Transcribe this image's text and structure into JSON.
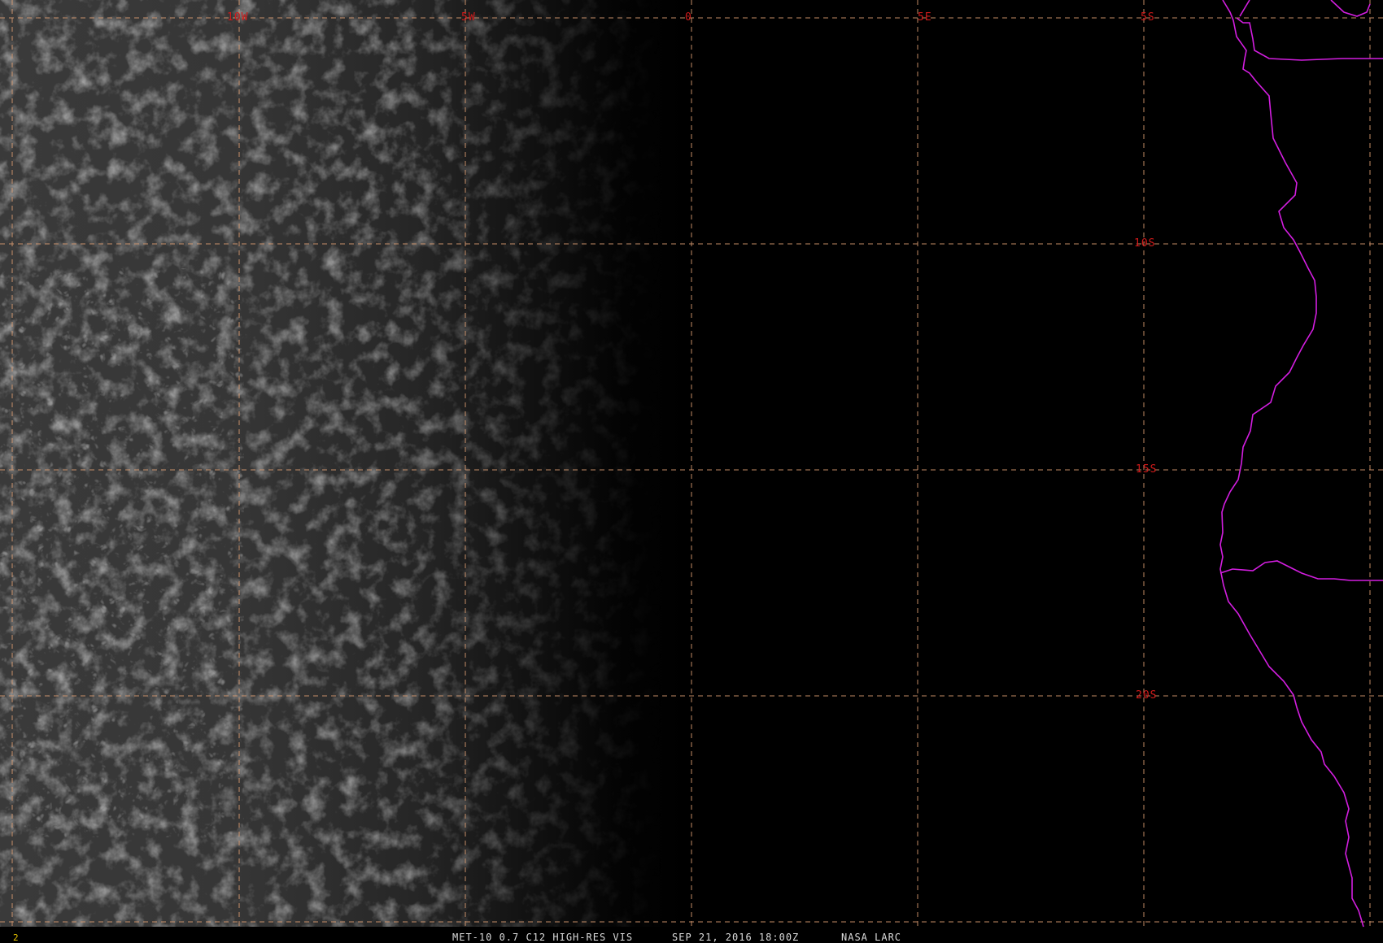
{
  "image": {
    "satellite": "MET-10",
    "channel": "0.7",
    "channel_code": "C12",
    "product": "HIGH-RES VIS",
    "date": "SEP 21, 2016",
    "time": "18:00Z",
    "source": "NASA LARC",
    "frame_number": "2"
  },
  "caption": {
    "text_left": "MET-10 0.7 C12 HIGH-RES VIS",
    "text_date": "SEP 21, 2016 18:00Z",
    "text_source": "NASA LARC"
  },
  "grid": {
    "longitude_labels": [
      "10W",
      "5W",
      "0",
      "5E"
    ],
    "latitude_labels": [
      "5S",
      "10S",
      "15S",
      "20S"
    ],
    "line_color": "#d89a70",
    "label_color": "#d01a1a"
  },
  "overlay": {
    "coastline_color": "#d31ee0",
    "border_color": "#d31ee0"
  },
  "scene": {
    "description_colors": {
      "cloud_bright": "#6a6a6a",
      "night_side": "#000000"
    }
  }
}
